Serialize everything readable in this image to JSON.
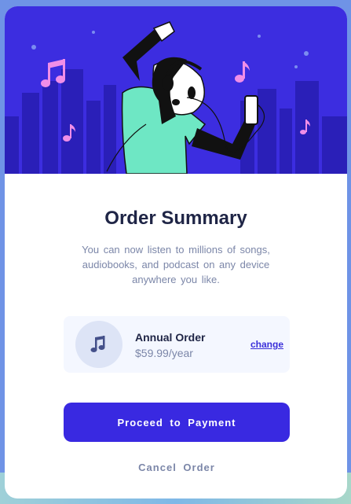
{
  "colors": {
    "page_background": "#6f93e6",
    "hero_background": "#3c2de0",
    "primary_button": "#3929e1",
    "title_text": "#1f2546",
    "muted_text": "#7b86a8",
    "plan_background": "#f4f7ff"
  },
  "hero": {
    "illustration": "person-dancing-with-headphones-and-phone",
    "icons": [
      "music-note-icon",
      "music-note-icon",
      "music-note-icon",
      "music-note-icon"
    ]
  },
  "summary": {
    "title": "Order Summary",
    "description": "You can now listen to millions of songs, audiobooks, and podcast on any device anywhere you like."
  },
  "plan": {
    "icon": "music-note-icon",
    "name": "Annual Order",
    "price": "$59.99/year",
    "change_label": "change"
  },
  "actions": {
    "proceed_label": "Proceed to Payment",
    "cancel_label": "Cancel Order"
  }
}
